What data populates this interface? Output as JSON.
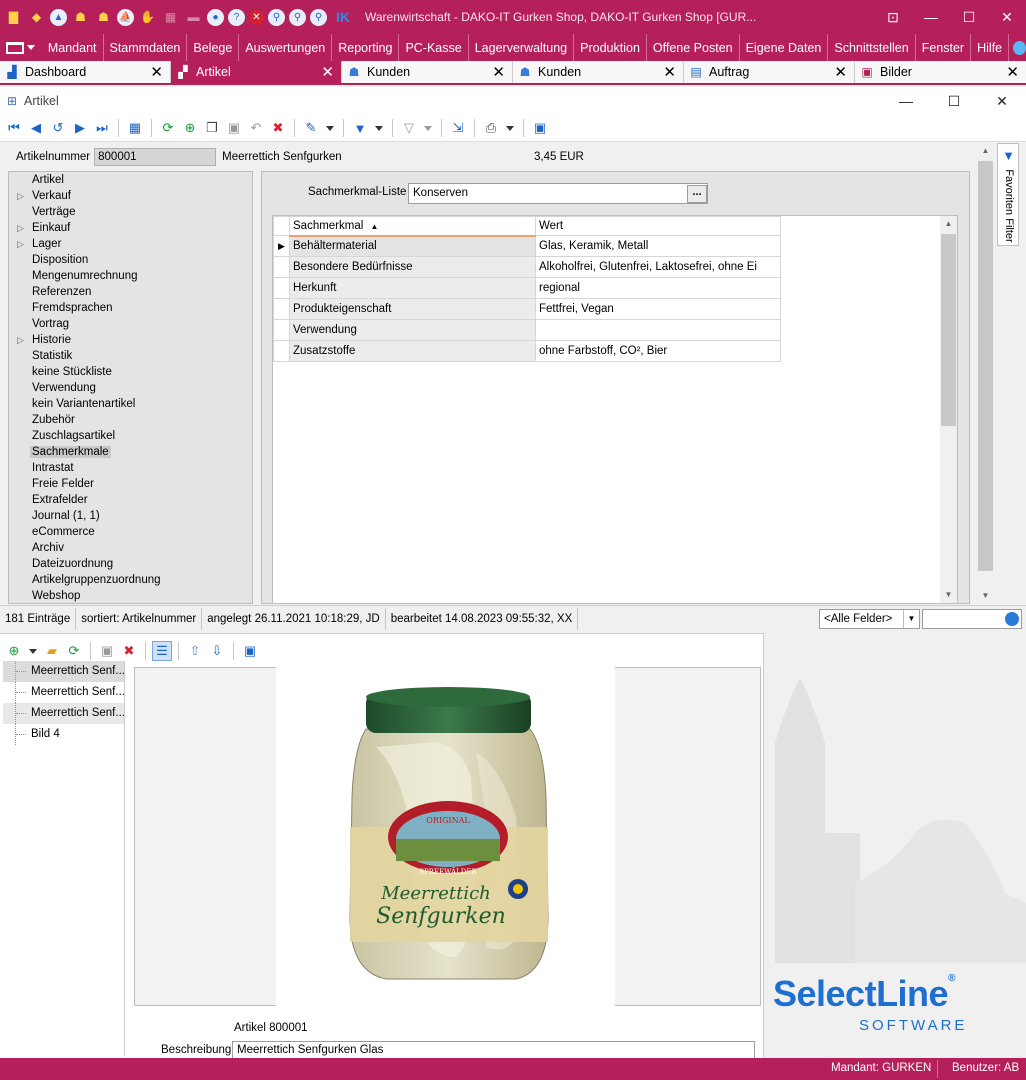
{
  "window": {
    "title": "Warenwirtschaft - DAKO-IT Gurken Shop, DAKO-IT Gurken Shop [GUR...",
    "quick_access_text": "IK"
  },
  "menu": {
    "items": [
      "Mandant",
      "Stammdaten",
      "Belege",
      "Auswertungen",
      "Reporting",
      "PC-Kasse",
      "Lagerverwaltung",
      "Produktion",
      "Offene Posten",
      "Eigene Daten",
      "Schnittstellen",
      "Fenster",
      "Hilfe"
    ]
  },
  "tabs": [
    {
      "label": "Dashboard",
      "icon": "dashboard-icon"
    },
    {
      "label": "Artikel",
      "icon": "article-icon"
    },
    {
      "label": "Kunden",
      "icon": "customer-icon"
    },
    {
      "label": "Kunden",
      "icon": "customer-icon"
    },
    {
      "label": "Auftrag",
      "icon": "order-icon"
    },
    {
      "label": "Bilder",
      "icon": "images-icon"
    }
  ],
  "subwindow": {
    "title": "Artikel"
  },
  "article": {
    "number_label": "Artikelnummer",
    "number": "800001",
    "name": "Meerrettich Senfgurken",
    "price": "3,45  EUR"
  },
  "nav": {
    "items": [
      {
        "label": "Artikel",
        "expandable": false
      },
      {
        "label": "Verkauf",
        "expandable": true
      },
      {
        "label": "Verträge",
        "expandable": false
      },
      {
        "label": "Einkauf",
        "expandable": true
      },
      {
        "label": "Lager",
        "expandable": true
      },
      {
        "label": "Disposition",
        "expandable": false
      },
      {
        "label": "Mengenumrechnung",
        "expandable": false
      },
      {
        "label": "Referenzen",
        "expandable": false
      },
      {
        "label": "Fremdsprachen",
        "expandable": false
      },
      {
        "label": "Vortrag",
        "expandable": false
      },
      {
        "label": "Historie",
        "expandable": true
      },
      {
        "label": "Statistik",
        "expandable": false
      },
      {
        "label": "keine Stückliste",
        "expandable": false
      },
      {
        "label": "Verwendung",
        "expandable": false
      },
      {
        "label": "kein Variantenartikel",
        "expandable": false
      },
      {
        "label": "Zubehör",
        "expandable": false
      },
      {
        "label": "Zuschlagsartikel",
        "expandable": false
      },
      {
        "label": "Sachmerkmale",
        "expandable": false,
        "selected": true
      },
      {
        "label": "Intrastat",
        "expandable": false
      },
      {
        "label": "Freie Felder",
        "expandable": false
      },
      {
        "label": "Extrafelder",
        "expandable": false
      },
      {
        "label": "Journal (1, 1)",
        "expandable": false
      },
      {
        "label": "eCommerce",
        "expandable": false
      },
      {
        "label": "Archiv",
        "expandable": false
      },
      {
        "label": "Dateizuordnung",
        "expandable": false
      },
      {
        "label": "Artikelgruppenzuordnung",
        "expandable": false
      },
      {
        "label": "Webshop",
        "expandable": false
      }
    ]
  },
  "sachmerkmal": {
    "list_label": "Sachmerkmal-Liste",
    "list_value": "Konserven",
    "browse_label": "...",
    "columns": [
      "Sachmerkmal",
      "Wert"
    ],
    "rows": [
      {
        "key": "Behältermaterial",
        "value": "Glas, Keramik, Metall",
        "current": true
      },
      {
        "key": "Besondere Bedürfnisse",
        "value": "Alkoholfrei, Glutenfrei, Laktosefrei, ohne Ei"
      },
      {
        "key": "Herkunft",
        "value": "regional"
      },
      {
        "key": "Produkteigenschaft",
        "value": "Fettfrei, Vegan"
      },
      {
        "key": "Verwendung",
        "value": ""
      },
      {
        "key": "Zusatzstoffe",
        "value": "ohne Farbstoff, CO², Bier"
      }
    ]
  },
  "favorites": {
    "label": "Favoriten Filter"
  },
  "status": {
    "count": "181 Einträge",
    "sort": "sortiert: Artikelnummer",
    "created": "angelegt 26.11.2021 10:18:29, JD",
    "edited": "bearbeitet 14.08.2023 09:55:32, XX",
    "filter_field": "<Alle Felder>"
  },
  "images": {
    "items": [
      "Meerrettich Senf...",
      "Meerrettich Senf...",
      "Meerrettich Senf...",
      "Bild 4"
    ],
    "caption_article": "Artikel 800001",
    "description_label": "Beschreibung",
    "description": "Meerrettich Senfgurken Glas",
    "jar_label_top": "ORIGINAL",
    "jar_label_region": "SPREEWÄLDER",
    "jar_label_name1": "Meerrettich",
    "jar_label_name2": "Senfgurken"
  },
  "brand": {
    "name": "SelectLine",
    "registered": "®",
    "sub": "SOFTWARE"
  },
  "footer": {
    "mandant": "Mandant: GURKEN",
    "user": "Benutzer: AB"
  },
  "colors": {
    "accent": "#b5205a",
    "brand_blue": "#1e6fcf"
  }
}
